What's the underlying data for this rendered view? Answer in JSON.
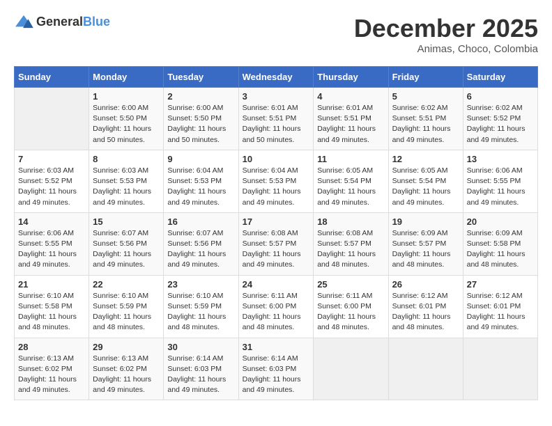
{
  "logo": {
    "general": "General",
    "blue": "Blue"
  },
  "title": "December 2025",
  "location": "Animas, Choco, Colombia",
  "days_of_week": [
    "Sunday",
    "Monday",
    "Tuesday",
    "Wednesday",
    "Thursday",
    "Friday",
    "Saturday"
  ],
  "weeks": [
    [
      {
        "num": "",
        "sunrise": "",
        "sunset": "",
        "daylight": ""
      },
      {
        "num": "1",
        "sunrise": "Sunrise: 6:00 AM",
        "sunset": "Sunset: 5:50 PM",
        "daylight": "Daylight: 11 hours and 50 minutes."
      },
      {
        "num": "2",
        "sunrise": "Sunrise: 6:00 AM",
        "sunset": "Sunset: 5:50 PM",
        "daylight": "Daylight: 11 hours and 50 minutes."
      },
      {
        "num": "3",
        "sunrise": "Sunrise: 6:01 AM",
        "sunset": "Sunset: 5:51 PM",
        "daylight": "Daylight: 11 hours and 50 minutes."
      },
      {
        "num": "4",
        "sunrise": "Sunrise: 6:01 AM",
        "sunset": "Sunset: 5:51 PM",
        "daylight": "Daylight: 11 hours and 49 minutes."
      },
      {
        "num": "5",
        "sunrise": "Sunrise: 6:02 AM",
        "sunset": "Sunset: 5:51 PM",
        "daylight": "Daylight: 11 hours and 49 minutes."
      },
      {
        "num": "6",
        "sunrise": "Sunrise: 6:02 AM",
        "sunset": "Sunset: 5:52 PM",
        "daylight": "Daylight: 11 hours and 49 minutes."
      }
    ],
    [
      {
        "num": "7",
        "sunrise": "Sunrise: 6:03 AM",
        "sunset": "Sunset: 5:52 PM",
        "daylight": "Daylight: 11 hours and 49 minutes."
      },
      {
        "num": "8",
        "sunrise": "Sunrise: 6:03 AM",
        "sunset": "Sunset: 5:53 PM",
        "daylight": "Daylight: 11 hours and 49 minutes."
      },
      {
        "num": "9",
        "sunrise": "Sunrise: 6:04 AM",
        "sunset": "Sunset: 5:53 PM",
        "daylight": "Daylight: 11 hours and 49 minutes."
      },
      {
        "num": "10",
        "sunrise": "Sunrise: 6:04 AM",
        "sunset": "Sunset: 5:53 PM",
        "daylight": "Daylight: 11 hours and 49 minutes."
      },
      {
        "num": "11",
        "sunrise": "Sunrise: 6:05 AM",
        "sunset": "Sunset: 5:54 PM",
        "daylight": "Daylight: 11 hours and 49 minutes."
      },
      {
        "num": "12",
        "sunrise": "Sunrise: 6:05 AM",
        "sunset": "Sunset: 5:54 PM",
        "daylight": "Daylight: 11 hours and 49 minutes."
      },
      {
        "num": "13",
        "sunrise": "Sunrise: 6:06 AM",
        "sunset": "Sunset: 5:55 PM",
        "daylight": "Daylight: 11 hours and 49 minutes."
      }
    ],
    [
      {
        "num": "14",
        "sunrise": "Sunrise: 6:06 AM",
        "sunset": "Sunset: 5:55 PM",
        "daylight": "Daylight: 11 hours and 49 minutes."
      },
      {
        "num": "15",
        "sunrise": "Sunrise: 6:07 AM",
        "sunset": "Sunset: 5:56 PM",
        "daylight": "Daylight: 11 hours and 49 minutes."
      },
      {
        "num": "16",
        "sunrise": "Sunrise: 6:07 AM",
        "sunset": "Sunset: 5:56 PM",
        "daylight": "Daylight: 11 hours and 49 minutes."
      },
      {
        "num": "17",
        "sunrise": "Sunrise: 6:08 AM",
        "sunset": "Sunset: 5:57 PM",
        "daylight": "Daylight: 11 hours and 49 minutes."
      },
      {
        "num": "18",
        "sunrise": "Sunrise: 6:08 AM",
        "sunset": "Sunset: 5:57 PM",
        "daylight": "Daylight: 11 hours and 48 minutes."
      },
      {
        "num": "19",
        "sunrise": "Sunrise: 6:09 AM",
        "sunset": "Sunset: 5:57 PM",
        "daylight": "Daylight: 11 hours and 48 minutes."
      },
      {
        "num": "20",
        "sunrise": "Sunrise: 6:09 AM",
        "sunset": "Sunset: 5:58 PM",
        "daylight": "Daylight: 11 hours and 48 minutes."
      }
    ],
    [
      {
        "num": "21",
        "sunrise": "Sunrise: 6:10 AM",
        "sunset": "Sunset: 5:58 PM",
        "daylight": "Daylight: 11 hours and 48 minutes."
      },
      {
        "num": "22",
        "sunrise": "Sunrise: 6:10 AM",
        "sunset": "Sunset: 5:59 PM",
        "daylight": "Daylight: 11 hours and 48 minutes."
      },
      {
        "num": "23",
        "sunrise": "Sunrise: 6:10 AM",
        "sunset": "Sunset: 5:59 PM",
        "daylight": "Daylight: 11 hours and 48 minutes."
      },
      {
        "num": "24",
        "sunrise": "Sunrise: 6:11 AM",
        "sunset": "Sunset: 6:00 PM",
        "daylight": "Daylight: 11 hours and 48 minutes."
      },
      {
        "num": "25",
        "sunrise": "Sunrise: 6:11 AM",
        "sunset": "Sunset: 6:00 PM",
        "daylight": "Daylight: 11 hours and 48 minutes."
      },
      {
        "num": "26",
        "sunrise": "Sunrise: 6:12 AM",
        "sunset": "Sunset: 6:01 PM",
        "daylight": "Daylight: 11 hours and 48 minutes."
      },
      {
        "num": "27",
        "sunrise": "Sunrise: 6:12 AM",
        "sunset": "Sunset: 6:01 PM",
        "daylight": "Daylight: 11 hours and 49 minutes."
      }
    ],
    [
      {
        "num": "28",
        "sunrise": "Sunrise: 6:13 AM",
        "sunset": "Sunset: 6:02 PM",
        "daylight": "Daylight: 11 hours and 49 minutes."
      },
      {
        "num": "29",
        "sunrise": "Sunrise: 6:13 AM",
        "sunset": "Sunset: 6:02 PM",
        "daylight": "Daylight: 11 hours and 49 minutes."
      },
      {
        "num": "30",
        "sunrise": "Sunrise: 6:14 AM",
        "sunset": "Sunset: 6:03 PM",
        "daylight": "Daylight: 11 hours and 49 minutes."
      },
      {
        "num": "31",
        "sunrise": "Sunrise: 6:14 AM",
        "sunset": "Sunset: 6:03 PM",
        "daylight": "Daylight: 11 hours and 49 minutes."
      },
      {
        "num": "",
        "sunrise": "",
        "sunset": "",
        "daylight": ""
      },
      {
        "num": "",
        "sunrise": "",
        "sunset": "",
        "daylight": ""
      },
      {
        "num": "",
        "sunrise": "",
        "sunset": "",
        "daylight": ""
      }
    ]
  ]
}
